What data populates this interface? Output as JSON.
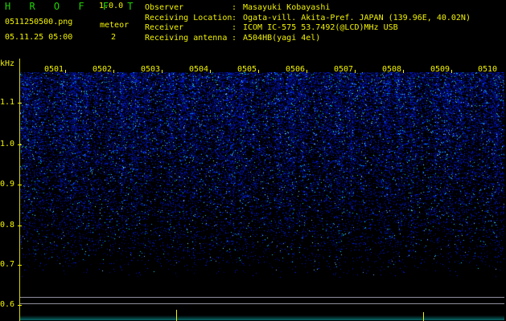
{
  "header": {
    "app_title": "H R O F F T",
    "version": "1.0.0",
    "filename": "0511250500.png",
    "datetime": "05.11.25 05:00",
    "meteor_label": "meteor",
    "meteor_count": "2"
  },
  "station": [
    {
      "key": "Observer",
      "value": "Masayuki Kobayashi"
    },
    {
      "key": "Receiving Location",
      "value": "Ogata-vill. Akita-Pref. JAPAN (139.96E, 40.02N)"
    },
    {
      "key": "Receiver",
      "value": "ICOM IC-575 53.7492(@LCD)MHz USB"
    },
    {
      "key": "Receiving antenna",
      "value": "A504HB(yagi 4el)"
    }
  ],
  "axis": {
    "unit": "kHz",
    "y_labels": [
      "1.1",
      "1.0",
      "0.9",
      "0.8",
      "0.7",
      "0.6"
    ],
    "x_labels": [
      "0501",
      "0502",
      "0503",
      "0504",
      "0505",
      "0506",
      "0507",
      "0508",
      "0509",
      "0510"
    ]
  },
  "colors": {
    "accent_green": "#22d200",
    "label_yellow": "#f2f200",
    "signal_blue": "#1a3cff"
  }
}
